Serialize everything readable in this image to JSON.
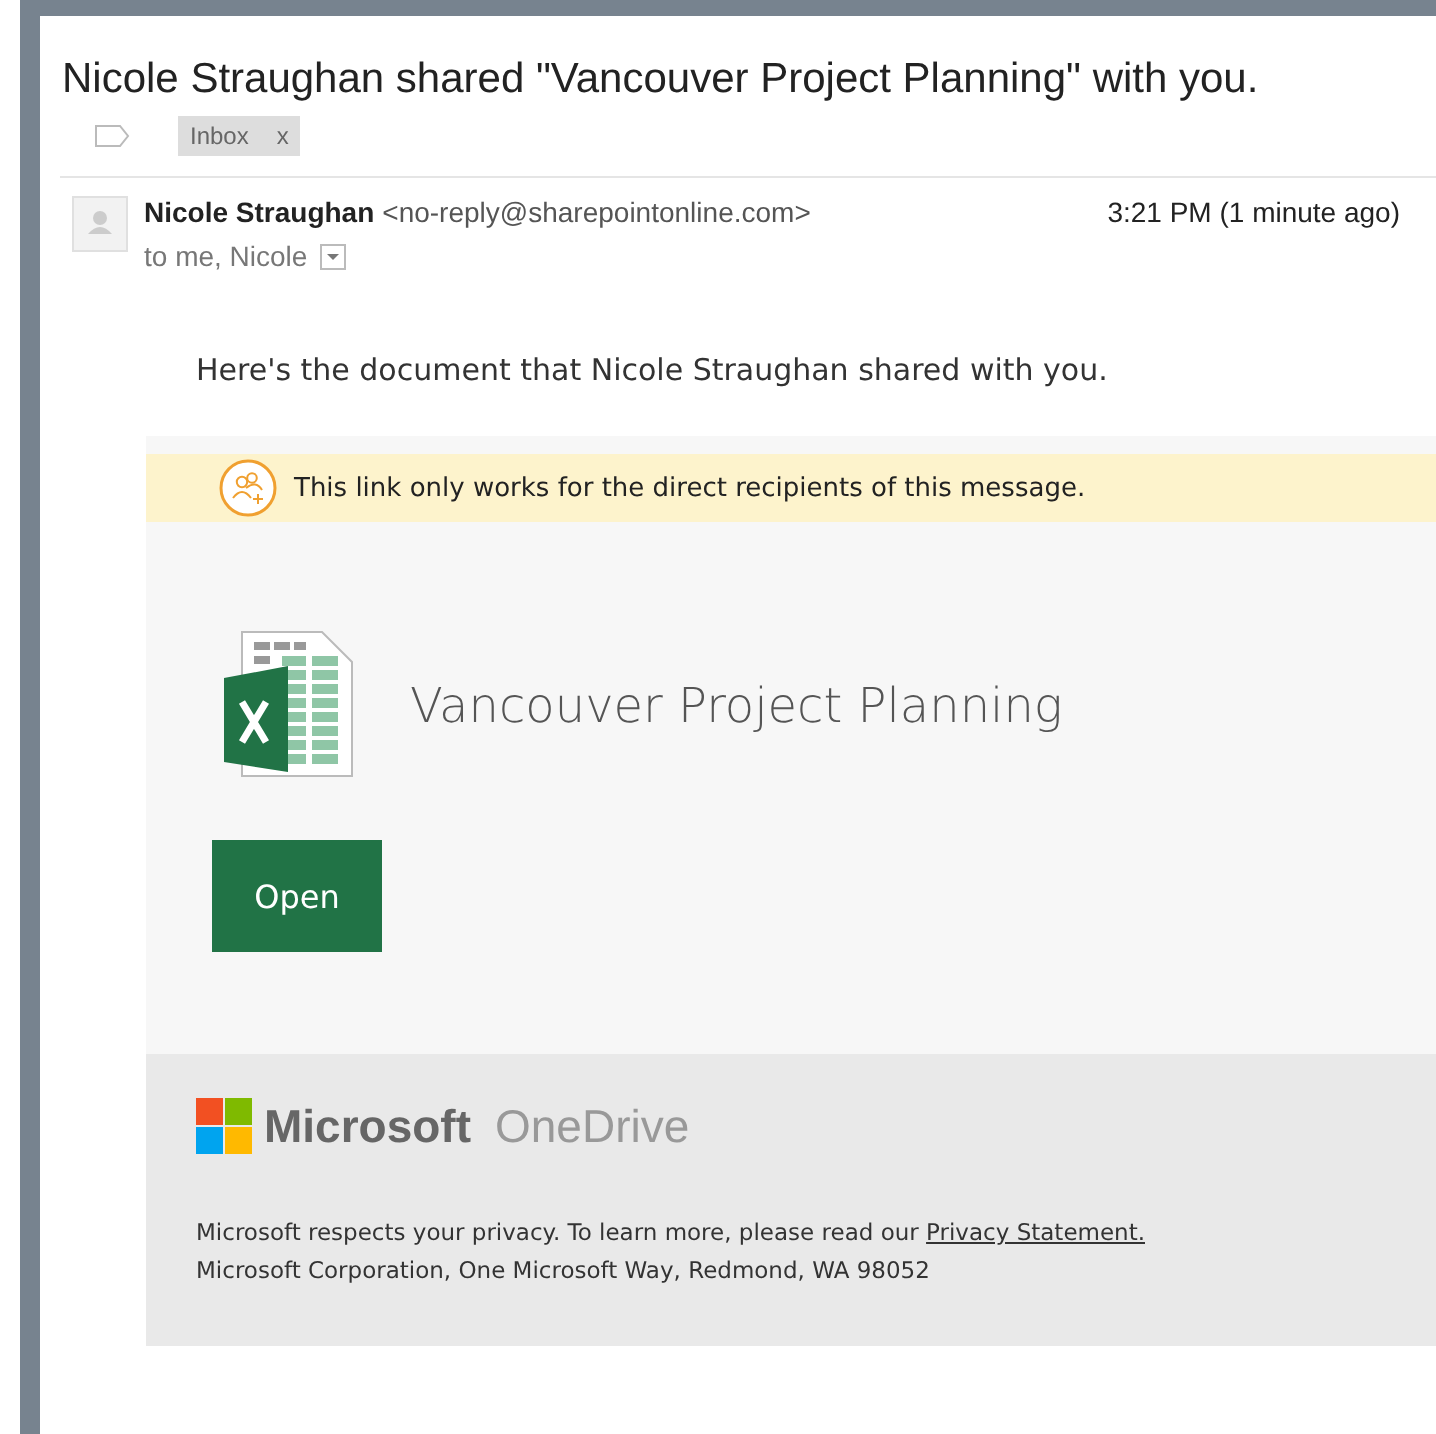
{
  "subject": "Nicole Straughan shared \"Vancouver Project Planning\" with you.",
  "labels": [
    {
      "name": "Inbox",
      "remove": "x"
    }
  ],
  "message": {
    "sender": "Nicole Straughan",
    "address": "<no-reply@sharepointonline.com>",
    "time": "3:21 PM (1 minute ago)",
    "recipients": "to me, Nicole"
  },
  "intro": "Here's the document that Nicole Straughan shared with you.",
  "notice": "This link only works for the direct recipients of this message.",
  "document": {
    "name": "Vancouver Project Planning",
    "button": "Open"
  },
  "footer": {
    "brand": "Microsoft",
    "product": "OneDrive",
    "privacy_text": "Microsoft respects your privacy. To learn more, please read our",
    "privacy_link": "Privacy Statement.",
    "address": "Microsoft Corporation, One Microsoft Way, Redmond, WA 98052"
  }
}
